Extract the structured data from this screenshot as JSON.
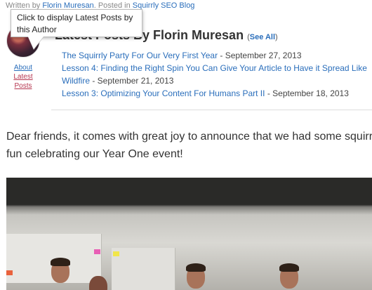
{
  "byline": {
    "written_by": "Written by ",
    "author": "Florin Muresan",
    "posted_in": ". Posted in ",
    "category": "Squirrly SEO Blog"
  },
  "author_box": {
    "about_label": "About",
    "latest_posts_label": "Latest Posts",
    "tooltip": "Click to display Latest Posts by this Author",
    "heading_visible": "Latest Posts By Florin Muresan",
    "see_all_open": "(",
    "see_all_label": "See All",
    "see_all_close": ")"
  },
  "posts": [
    {
      "title": "The Squirrly Party For Our Very First Year",
      "date": " - September 27, 2013"
    },
    {
      "title": "Lesson 4: Finding the Right Spin You Can Give Your Article to Have it Spread Like Wildfire",
      "date": " - September 21, 2013"
    },
    {
      "title": "Lesson 3: Optimizing Your Content For Humans Part II",
      "date": " - September 18, 2013"
    }
  ],
  "article": {
    "intro": "Dear friends, it comes with great joy to announce that we had some squirrly fun celebrating our Year One event!"
  },
  "colors": {
    "link": "#2a6ebb",
    "latest_posts_link": "#b5344e",
    "text": "#333333"
  }
}
